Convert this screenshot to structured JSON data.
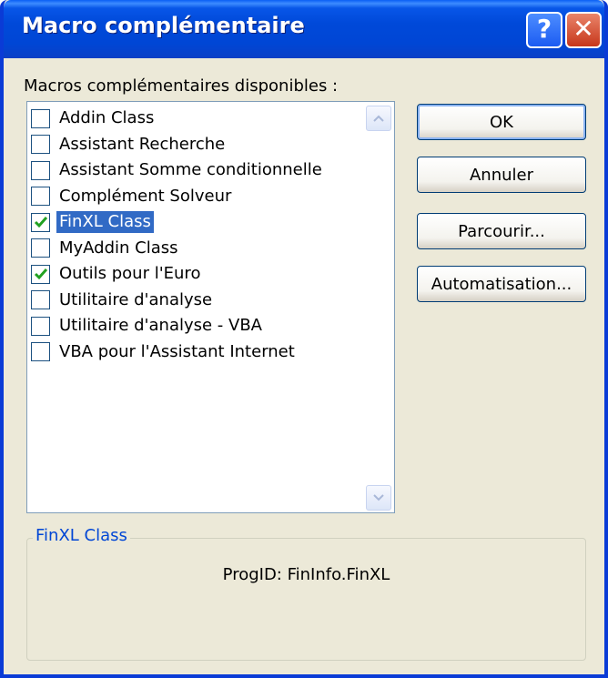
{
  "window": {
    "title": "Macro complémentaire"
  },
  "titlebar": {
    "help_label": "?",
    "close_label": "✕"
  },
  "addins": {
    "label": "Macros complémentaires disponibles :",
    "items": [
      {
        "label": "Addin Class",
        "checked": false,
        "selected": false
      },
      {
        "label": "Assistant Recherche",
        "checked": false,
        "selected": false
      },
      {
        "label": "Assistant Somme conditionnelle",
        "checked": false,
        "selected": false
      },
      {
        "label": "Complément Solveur",
        "checked": false,
        "selected": false
      },
      {
        "label": "FinXL Class",
        "checked": true,
        "selected": true
      },
      {
        "label": "MyAddin Class",
        "checked": false,
        "selected": false
      },
      {
        "label": "Outils pour l'Euro",
        "checked": true,
        "selected": false
      },
      {
        "label": "Utilitaire d'analyse",
        "checked": false,
        "selected": false
      },
      {
        "label": "Utilitaire d'analyse - VBA",
        "checked": false,
        "selected": false
      },
      {
        "label": "VBA pour l'Assistant Internet",
        "checked": false,
        "selected": false
      }
    ]
  },
  "buttons": {
    "ok": "OK",
    "cancel": "Annuler",
    "browse": "Parcourir...",
    "automation": "Automatisation..."
  },
  "details": {
    "title": "FinXL Class",
    "progid": "ProgID: FinInfo.FinXL"
  },
  "colors": {
    "titlebar": "#0054e3",
    "selection": "#316ac5",
    "check": "#21a121",
    "legend": "#0046d5"
  }
}
